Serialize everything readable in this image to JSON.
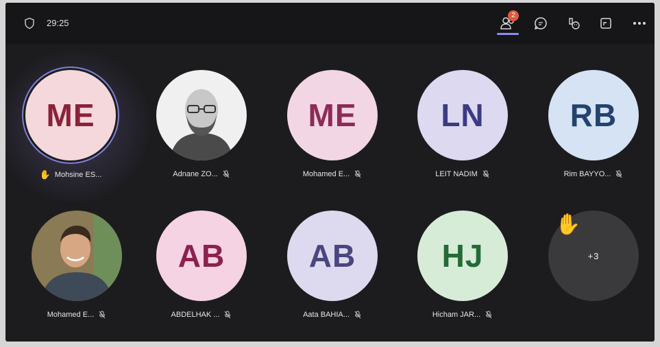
{
  "meeting": {
    "timer": "29:25"
  },
  "toolbar": {
    "participants_badge": "2",
    "buttons": [
      "people-icon",
      "chat-icon",
      "react-icon",
      "share-icon",
      "more-icon"
    ]
  },
  "participants": [
    {
      "initials": "ME",
      "name": "Mohsine ES...",
      "bg": "#f4d8dc",
      "fg": "#8a2238",
      "hand": true,
      "speaking": true
    },
    {
      "initials": "",
      "name": "Adnane ZO...",
      "photo": true,
      "muted": true
    },
    {
      "initials": "ME",
      "name": "Mohamed E...",
      "bg": "#f2d6e4",
      "fg": "#8d2b58",
      "muted": true
    },
    {
      "initials": "LN",
      "name": "LEIT NADIM",
      "bg": "#dcd9f1",
      "fg": "#3d3a84",
      "muted": true
    },
    {
      "initials": "RB",
      "name": "Rim BAYYO...",
      "bg": "#d5e3f4",
      "fg": "#24426f",
      "muted": true
    },
    {
      "initials": "",
      "name": "Mohamed E...",
      "photo": true,
      "muted": true
    },
    {
      "initials": "AB",
      "name": "ABDELHAK ...",
      "bg": "#f5d3e3",
      "fg": "#8c2150",
      "muted": true
    },
    {
      "initials": "AB",
      "name": "Aata BAHIA...",
      "bg": "#dddaef",
      "fg": "#4a4680",
      "muted": true
    },
    {
      "initials": "HJ",
      "name": "Hicham JAR...",
      "bg": "#d7ecd6",
      "fg": "#236b36",
      "muted": true
    }
  ],
  "overflow": {
    "label": "+3",
    "hand": true
  },
  "colors": {
    "background": "#1c1c1f",
    "accent": "#8b8cf2",
    "badge": "#e2583e"
  }
}
